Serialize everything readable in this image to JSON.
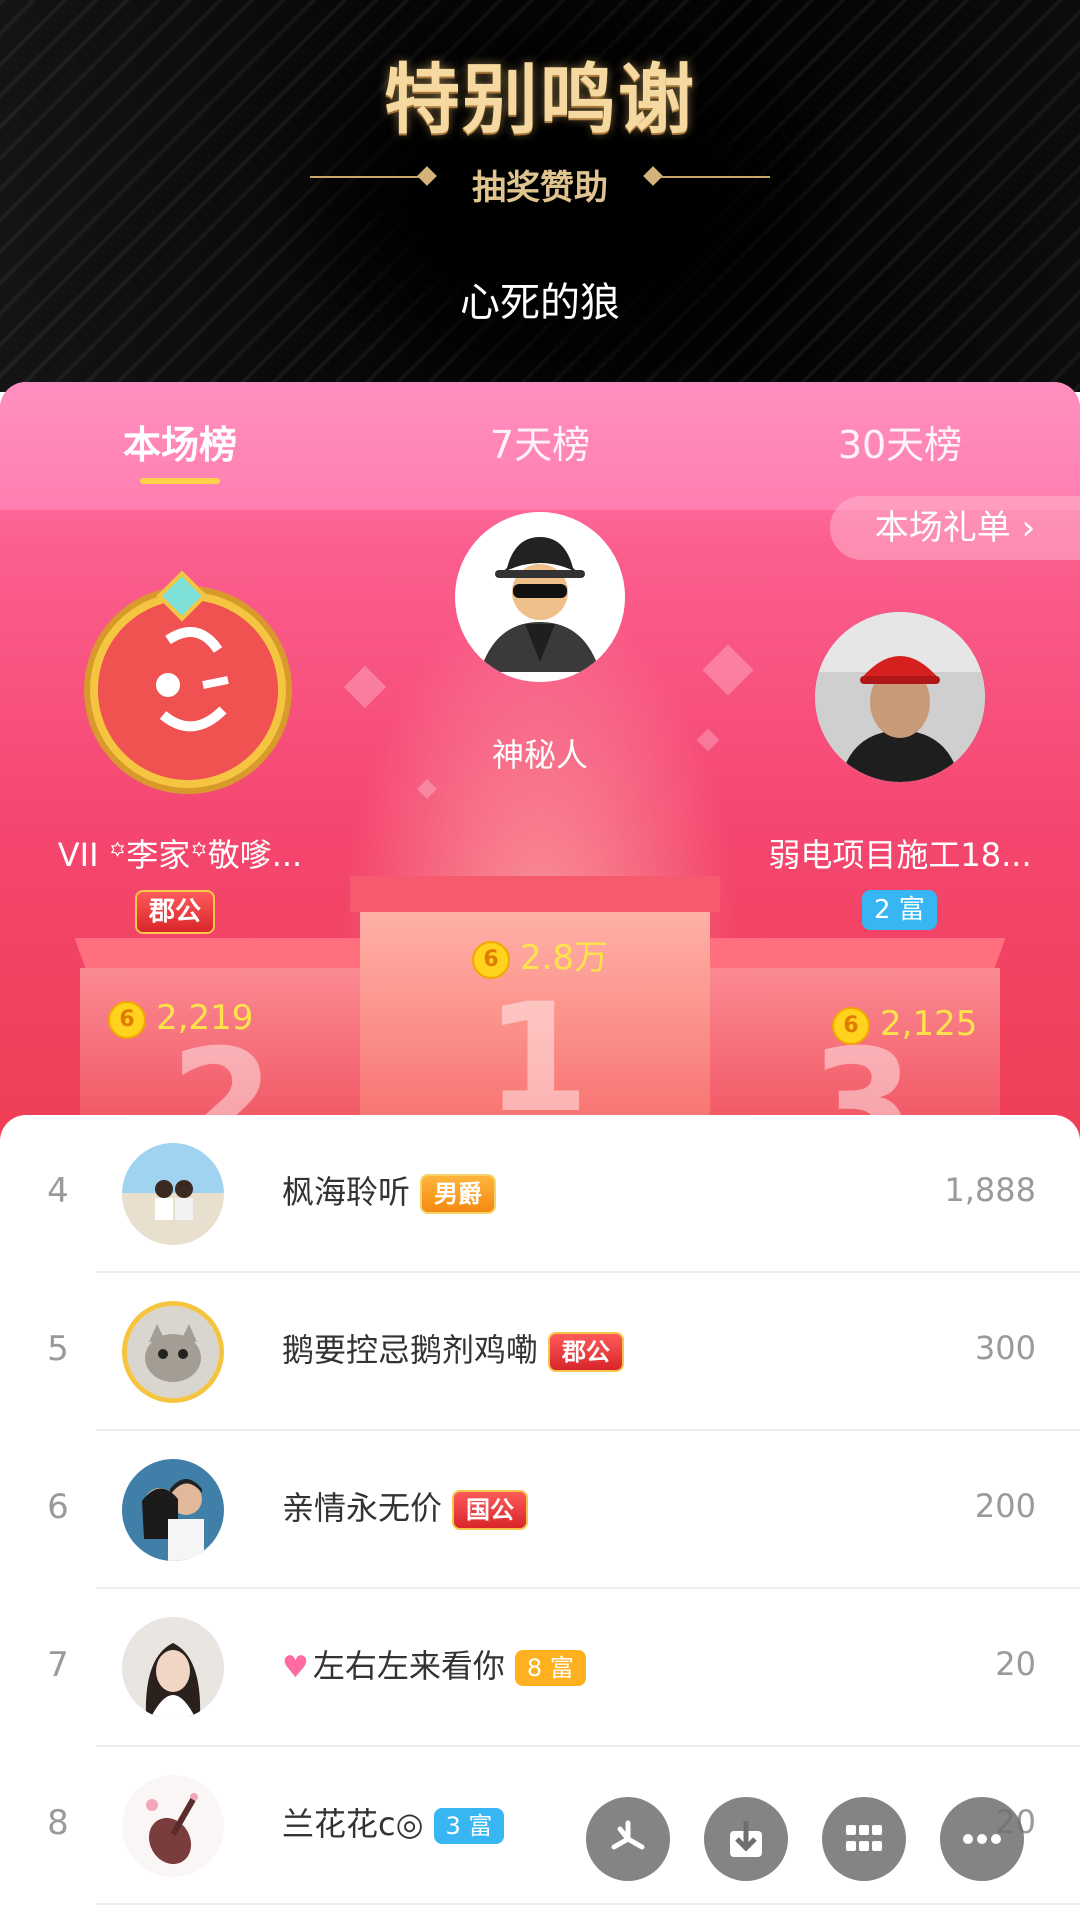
{
  "banner": {
    "title": "特别鸣谢",
    "subtitle": "抽奖赞助",
    "sponsor": "心死的狼"
  },
  "tabs": [
    {
      "label": "本场榜",
      "active": true
    },
    {
      "label": "7天榜",
      "active": false
    },
    {
      "label": "30天榜",
      "active": false
    }
  ],
  "gift_list_label": "本场礼单",
  "top3": {
    "first": {
      "name": "神秘人",
      "score": "2.8万"
    },
    "second": {
      "name": "VII ꙳李家꙳敬嗲...",
      "badge": "郡公",
      "score": "2,219"
    },
    "third": {
      "name": "弱电项目施工18...",
      "badge": "2 富",
      "score": "2,125"
    }
  },
  "podium_numbers": [
    "1",
    "2",
    "3"
  ],
  "list": [
    {
      "rank": "4",
      "name": "枫海聆听",
      "badge": "男爵",
      "score": "1,888"
    },
    {
      "rank": "5",
      "name": "鹅要控忌鹅剂鸡嘞",
      "badge": "郡公",
      "score": "300"
    },
    {
      "rank": "6",
      "name": "亲情永无价",
      "badge": "国公",
      "score": "200"
    },
    {
      "rank": "7",
      "name": "左右左来看你",
      "badge": "8 富",
      "score": "20"
    },
    {
      "rank": "8",
      "name": "兰花花c◎",
      "badge": "3 富",
      "score": "20"
    }
  ],
  "coin_symbol": "6",
  "fab_icons": [
    "share-icon",
    "download-icon",
    "grid-icon",
    "more-icon"
  ],
  "colors": {
    "accent_pink": "#ff7fb0",
    "score_yellow": "#ffe34a",
    "tab_underline": "#ffd24a"
  }
}
